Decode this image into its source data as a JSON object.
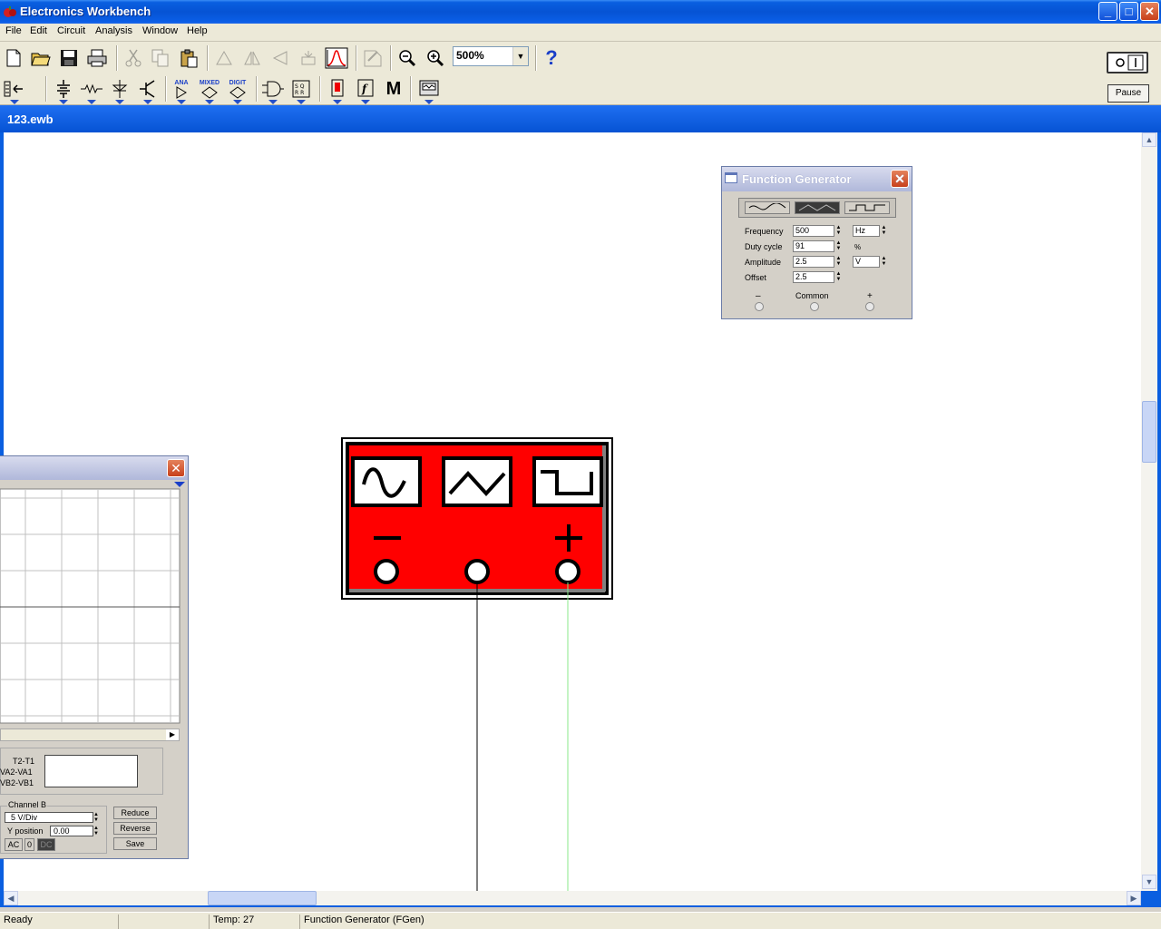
{
  "app": {
    "title": "Electronics Workbench"
  },
  "menu": [
    "File",
    "Edit",
    "Circuit",
    "Analysis",
    "Window",
    "Help"
  ],
  "toolbar": {
    "zoom_value": "500%",
    "help_label": "?",
    "pause_label": "Pause",
    "power_label": "O I",
    "ana_label": "ANA",
    "mixed_label": "MIXED",
    "digit_label": "DIGIT",
    "m_label": "M"
  },
  "document": {
    "title": "123.ewb"
  },
  "function_generator": {
    "title": "Function Generator",
    "frequency_label": "Frequency",
    "frequency_value": "500",
    "frequency_unit": "Hz",
    "duty_label": "Duty cycle",
    "duty_value": "91",
    "duty_unit": "%",
    "amplitude_label": "Amplitude",
    "amplitude_value": "2.5",
    "amplitude_unit": "V",
    "offset_label": "Offset",
    "offset_value": "2.5",
    "minus_label": "–",
    "common_label": "Common",
    "plus_label": "+"
  },
  "oscilloscope": {
    "t2t1": "T2-T1",
    "va2va1": "VA2-VA1",
    "vb2vb1": "VB2-VB1",
    "channel_b": "Channel B",
    "vdiv": "5  V/Div",
    "ypos_label": "Y position",
    "ypos_value": "0.00",
    "ac": "AC",
    "zero": "0",
    "dc": "DC",
    "reduce": "Reduce",
    "reverse": "Reverse",
    "save": "Save"
  },
  "status": {
    "ready": "Ready",
    "temp": "Temp:  27",
    "component": "Function Generator (FGen)"
  },
  "colors": {
    "fg_body": "#ff0000",
    "wire_plus": "#88e888",
    "wire_common": "#000000"
  }
}
